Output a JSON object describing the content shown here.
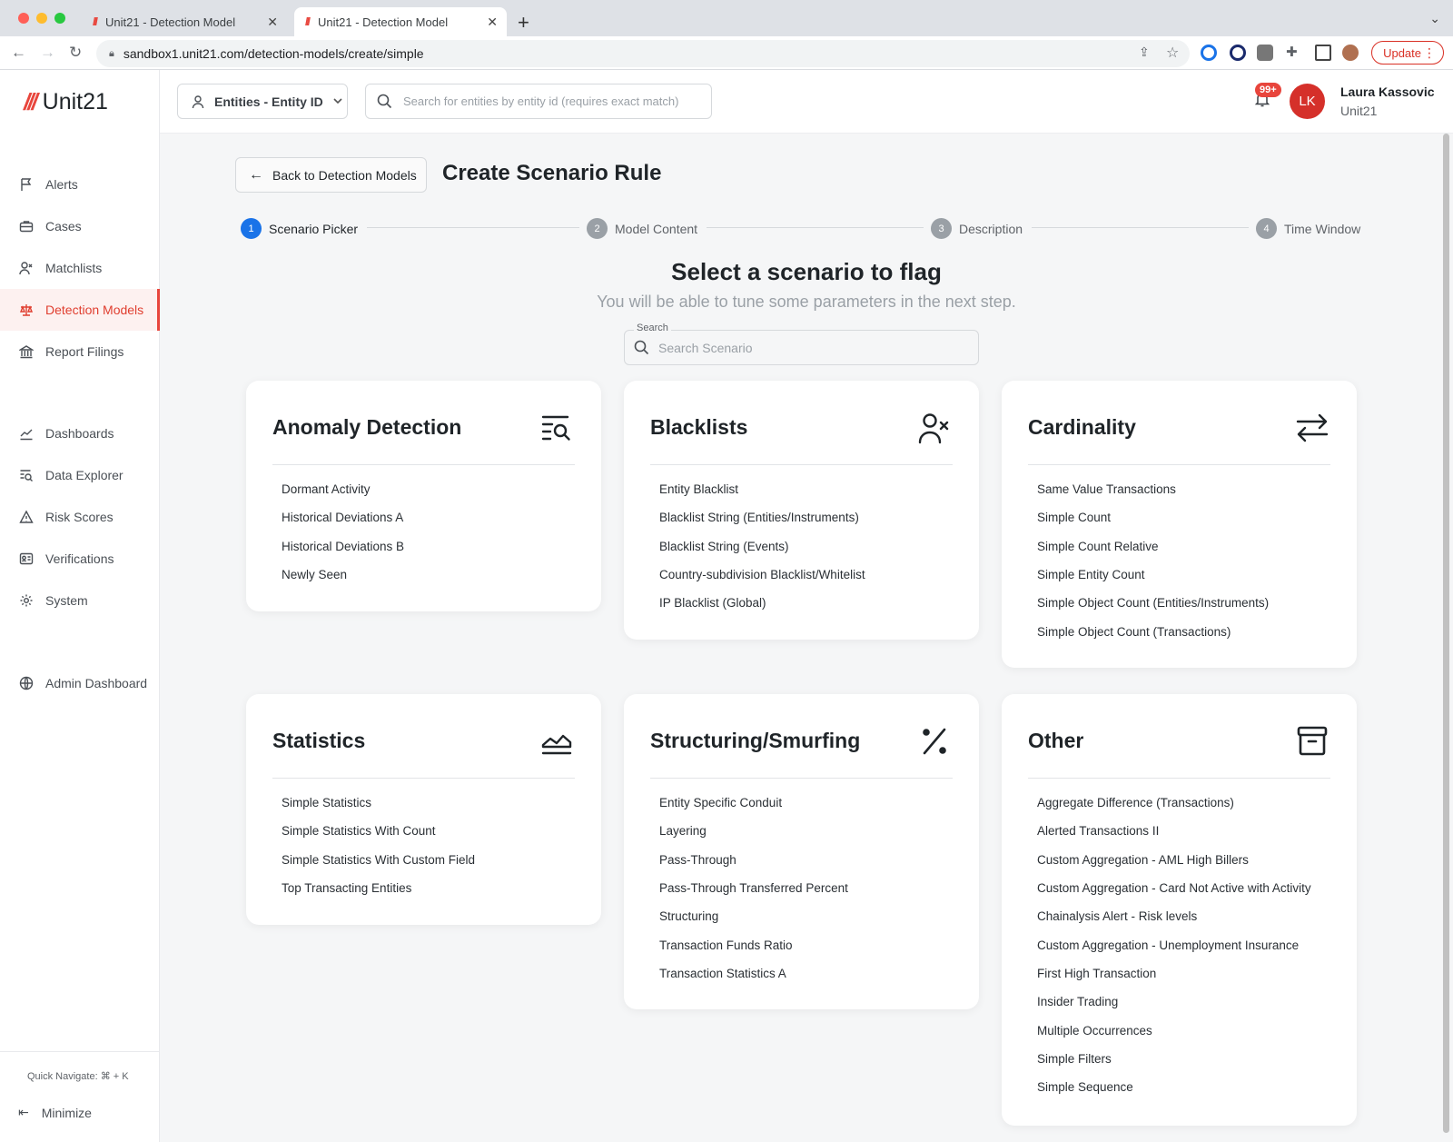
{
  "browser": {
    "tabs": [
      {
        "title": "Unit21 - Detection Model",
        "active": false
      },
      {
        "title": "Unit21 - Detection Model",
        "active": true
      }
    ],
    "url": "sandbox1.unit21.com/detection-models/create/simple",
    "update_label": "Update"
  },
  "app": {
    "logo_text": "Unit21",
    "brand_color": "#e8453c"
  },
  "sidebar": {
    "primary": [
      {
        "label": "Alerts",
        "icon": "flag-icon"
      },
      {
        "label": "Cases",
        "icon": "briefcase-icon"
      },
      {
        "label": "Matchlists",
        "icon": "user-x-icon"
      },
      {
        "label": "Detection Models",
        "icon": "scale-icon",
        "active": true
      },
      {
        "label": "Report Filings",
        "icon": "bank-icon"
      }
    ],
    "secondary": [
      {
        "label": "Dashboards",
        "icon": "chart-line-icon"
      },
      {
        "label": "Data Explorer",
        "icon": "list-search-icon"
      },
      {
        "label": "Risk Scores",
        "icon": "warning-icon"
      },
      {
        "label": "Verifications",
        "icon": "id-card-icon"
      },
      {
        "label": "System",
        "icon": "gear-icon"
      }
    ],
    "tertiary": [
      {
        "label": "Admin Dashboard",
        "icon": "globe-icon"
      }
    ],
    "quick_navigate": "Quick Navigate: ⌘ + K",
    "minimize": "Minimize"
  },
  "topbar": {
    "entity_selector": "Entities - Entity ID",
    "search_placeholder": "Search for entities by entity id (requires exact match)",
    "notifications_badge": "99+",
    "user_initials": "LK",
    "user_name": "Laura Kassovic",
    "user_org": "Unit21"
  },
  "page": {
    "back_label": "Back to Detection Models",
    "title": "Create Scenario Rule",
    "steps": [
      {
        "num": "1",
        "label": "Scenario Picker",
        "active": true
      },
      {
        "num": "2",
        "label": "Model Content",
        "active": false
      },
      {
        "num": "3",
        "label": "Description",
        "active": false
      },
      {
        "num": "4",
        "label": "Time Window",
        "active": false
      }
    ],
    "heading": "Select a scenario to flag",
    "subheading": "You will be able to tune some parameters in the next step.",
    "search_label": "Search",
    "search_placeholder": "Search Scenario"
  },
  "categories": [
    {
      "title": "Anomaly Detection",
      "icon": "list-search-icon",
      "items": [
        "Dormant Activity",
        "Historical Deviations A",
        "Historical Deviations B",
        "Newly Seen"
      ]
    },
    {
      "title": "Blacklists",
      "icon": "user-x-icon",
      "items": [
        "Entity Blacklist",
        "Blacklist String (Entities/Instruments)",
        "Blacklist String (Events)",
        "Country-subdivision Blacklist/Whitelist",
        "IP Blacklist (Global)"
      ]
    },
    {
      "title": "Cardinality",
      "icon": "arrows-exchange-icon",
      "items": [
        "Same Value Transactions",
        "Simple Count",
        "Simple Count Relative",
        "Simple Entity Count",
        "Simple Object Count (Entities/Instruments)",
        "Simple Object Count (Transactions)"
      ]
    },
    {
      "title": "Statistics",
      "icon": "chart-area-icon",
      "items": [
        "Simple Statistics",
        "Simple Statistics With Count",
        "Simple Statistics With Custom Field",
        "Top Transacting Entities"
      ]
    },
    {
      "title": "Structuring/Smurfing",
      "icon": "percent-icon",
      "items": [
        "Entity Specific Conduit",
        "Layering",
        "Pass-Through",
        "Pass-Through Transferred Percent",
        "Structuring",
        "Transaction Funds Ratio",
        "Transaction Statistics A"
      ]
    },
    {
      "title": "Other",
      "icon": "archive-icon",
      "items": [
        "Aggregate Difference (Transactions)",
        "Alerted Transactions II",
        "Custom Aggregation - AML High Billers",
        "Custom Aggregation - Card Not Active with Activity",
        "Chainalysis Alert - Risk levels",
        "Custom Aggregation - Unemployment Insurance",
        "First High Transaction",
        "Insider Trading",
        "Multiple Occurrences",
        "Simple Filters",
        "Simple Sequence"
      ]
    }
  ]
}
